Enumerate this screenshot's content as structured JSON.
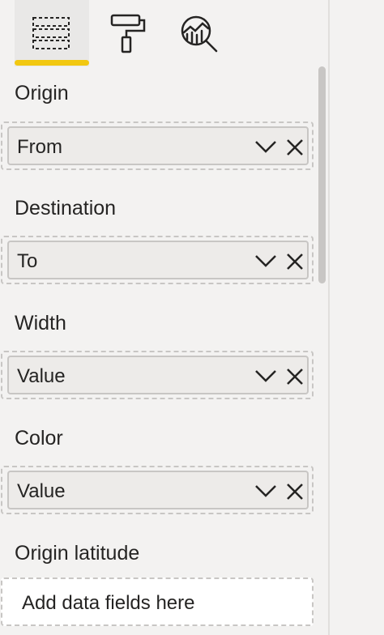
{
  "tabs": [
    {
      "icon": "fields-icon",
      "active": true
    },
    {
      "icon": "format-paint-roller-icon",
      "active": false
    },
    {
      "icon": "analytics-magnifier-icon",
      "active": false
    }
  ],
  "accent_color": "#f2c811",
  "wells": [
    {
      "label": "Origin",
      "field": "From"
    },
    {
      "label": "Destination",
      "field": "To"
    },
    {
      "label": "Width",
      "field": "Value"
    },
    {
      "label": "Color",
      "field": "Value"
    }
  ],
  "empty_well": {
    "label": "Origin latitude",
    "placeholder": "Add data fields here"
  }
}
